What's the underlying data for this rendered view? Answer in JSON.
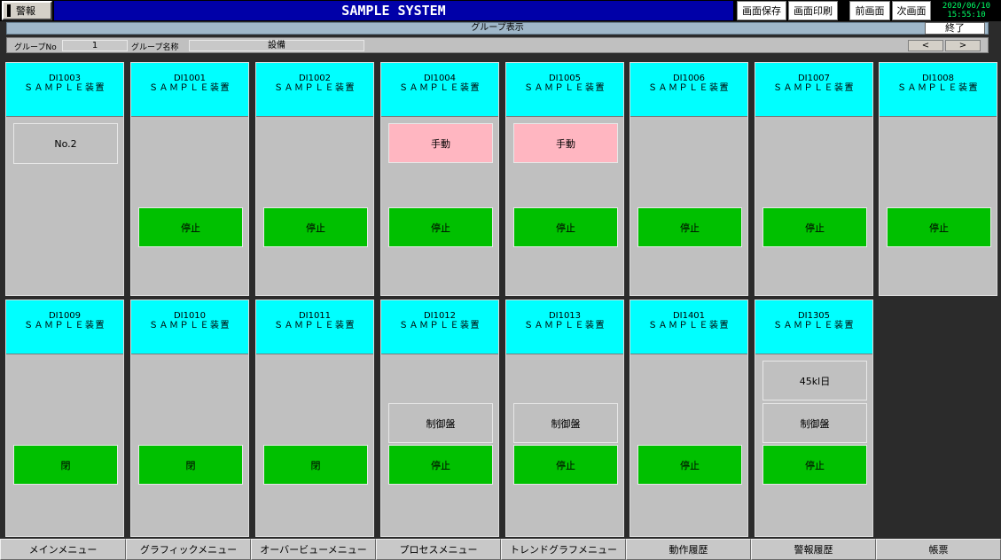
{
  "header": {
    "alarm_label": "警報",
    "title": "SAMPLE SYSTEM",
    "save_screen": "画面保存",
    "print_screen": "画面印刷",
    "prev_screen": "前画面",
    "next_screen": "次画面",
    "date": "2020/06/10",
    "time": "15:55:10"
  },
  "group_bar": {
    "title": "グループ表示",
    "exit_label": "終了",
    "group_no_label": "グループNo",
    "group_no": "1",
    "group_name_label": "グループ名称",
    "group_name": "設備",
    "prev_arrow": "<",
    "next_arrow": ">"
  },
  "cards": [
    {
      "id": "DI1003",
      "name": "ＳＡＭＰＬＥ装置",
      "tiles": [
        {
          "text": "No.2",
          "color": "gray"
        }
      ]
    },
    {
      "id": "DI1001",
      "name": "ＳＡＭＰＬＥ装置",
      "tiles": [
        {
          "text": "停止",
          "color": "green"
        }
      ]
    },
    {
      "id": "DI1002",
      "name": "ＳＡＭＰＬＥ装置",
      "tiles": [
        {
          "text": "停止",
          "color": "green"
        }
      ]
    },
    {
      "id": "DI1004",
      "name": "ＳＡＭＰＬＥ装置",
      "tiles": [
        {
          "text": "手動",
          "color": "pink"
        },
        {
          "text": "停止",
          "color": "green"
        }
      ]
    },
    {
      "id": "DI1005",
      "name": "ＳＡＭＰＬＥ装置",
      "tiles": [
        {
          "text": "手動",
          "color": "pink"
        },
        {
          "text": "停止",
          "color": "green"
        }
      ]
    },
    {
      "id": "DI1006",
      "name": "ＳＡＭＰＬＥ装置",
      "tiles": [
        {
          "text": "停止",
          "color": "green"
        }
      ]
    },
    {
      "id": "DI1007",
      "name": "ＳＡＭＰＬＥ装置",
      "tiles": [
        {
          "text": "停止",
          "color": "green"
        }
      ]
    },
    {
      "id": "DI1008",
      "name": "ＳＡＭＰＬＥ装置",
      "tiles": [
        {
          "text": "停止",
          "color": "green"
        }
      ]
    },
    {
      "id": "DI1009",
      "name": "ＳＡＭＰＬＥ装置",
      "tiles": [
        {
          "text": "閉",
          "color": "green"
        }
      ]
    },
    {
      "id": "DI1010",
      "name": "ＳＡＭＰＬＥ装置",
      "tiles": [
        {
          "text": "閉",
          "color": "green"
        }
      ]
    },
    {
      "id": "DI1011",
      "name": "ＳＡＭＰＬＥ装置",
      "tiles": [
        {
          "text": "閉",
          "color": "green"
        }
      ]
    },
    {
      "id": "DI1012",
      "name": "ＳＡＭＰＬＥ装置",
      "tiles": [
        {
          "text": "制御盤",
          "color": "gray"
        },
        {
          "text": "停止",
          "color": "green"
        }
      ]
    },
    {
      "id": "DI1013",
      "name": "ＳＡＭＰＬＥ装置",
      "tiles": [
        {
          "text": "制御盤",
          "color": "gray"
        },
        {
          "text": "停止",
          "color": "green"
        }
      ]
    },
    {
      "id": "DI1401",
      "name": "ＳＡＭＰＬＥ装置",
      "tiles": [
        {
          "text": "停止",
          "color": "green"
        }
      ]
    },
    {
      "id": "DI1305",
      "name": "ＳＡＭＰＬＥ装置",
      "tiles": [
        {
          "text": "45kl日",
          "color": "gray"
        },
        {
          "text": "制御盤",
          "color": "gray"
        },
        {
          "text": "停止",
          "color": "green"
        }
      ]
    }
  ],
  "bottom_menu": [
    "メインメニュー",
    "グラフィックメニュー",
    "オーバービューメニュー",
    "プロセスメニュー",
    "トレンドグラフメニュー",
    "動作履歴",
    "警報履歴",
    "帳票"
  ],
  "colors": {
    "title_bg": "#0000a8",
    "card_head": "#00ffff",
    "status_green": "#00c000",
    "status_pink": "#ffb6c1",
    "panel_gray": "#c0c0c0",
    "clock_text": "#00ff66"
  }
}
